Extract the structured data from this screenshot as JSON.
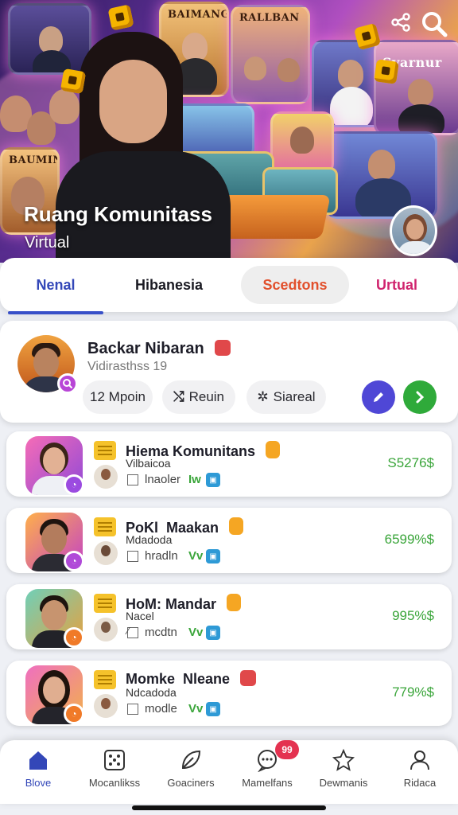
{
  "hero": {
    "title": "Ruang Komunitass",
    "subtitle": "Virtual",
    "card_captions": [
      "BAIMANGAM",
      "RALLBAN",
      "Svarnur",
      "BAUMIN"
    ]
  },
  "top_icons": [
    "share-icon",
    "search-icon"
  ],
  "tabs": [
    {
      "label": "Nenal"
    },
    {
      "label": "Hibanesia"
    },
    {
      "label": "Scedtons"
    },
    {
      "label": "Urtual"
    }
  ],
  "profile": {
    "name": "Backar Nibaran",
    "subtitle": "Vidirasthss 19",
    "chips": [
      {
        "label": "12 Mpoin",
        "icon": ""
      },
      {
        "label": "Reuin",
        "icon": "shuffle-icon"
      },
      {
        "label": "Siareal",
        "icon": "gear-icon"
      }
    ]
  },
  "list": [
    {
      "title": "Hiema Komunitans",
      "sub": "Vilbaicoa",
      "meta": "lnaoler",
      "vv": "Iw",
      "value": "S5276$",
      "badge_color": "#9b4be0",
      "flag_color": "#f5a623"
    },
    {
      "title": "PoKl  Maakan",
      "sub": "Mdadoda",
      "meta": "hradln",
      "vv": "Vv",
      "value": "6599%$",
      "badge_color": "#b04ad8",
      "flag_color": "#f5a623"
    },
    {
      "title": "HoM: Mandar",
      "sub": "Nacel",
      "meta": "mcdtn",
      "vv": "Vv",
      "value": "995%$",
      "badge_color": "#f07a28",
      "flag_color": "#f5a623"
    },
    {
      "title": "Momke  Nleane",
      "sub": "Ndcadoda",
      "meta": "modle",
      "vv": "Vv",
      "value": "779%$",
      "badge_color": "#f07a28",
      "flag_color": "#e0484a"
    }
  ],
  "nav": [
    {
      "label": "Blove",
      "icon": "home-icon"
    },
    {
      "label": "Mocanlikss",
      "icon": "dice-icon"
    },
    {
      "label": "Goaciners",
      "icon": "leaf-icon"
    },
    {
      "label": "Mamelfans",
      "icon": "chat-icon",
      "badge": "99"
    },
    {
      "label": "Dewmanis",
      "icon": "star-icon"
    },
    {
      "label": "Ridaca",
      "icon": "profile-icon"
    }
  ],
  "colors": {
    "accent": "#3347b8",
    "green": "#3aa53a",
    "orange": "#e2502c",
    "pink": "#d0246e",
    "badge": "#e43250"
  }
}
